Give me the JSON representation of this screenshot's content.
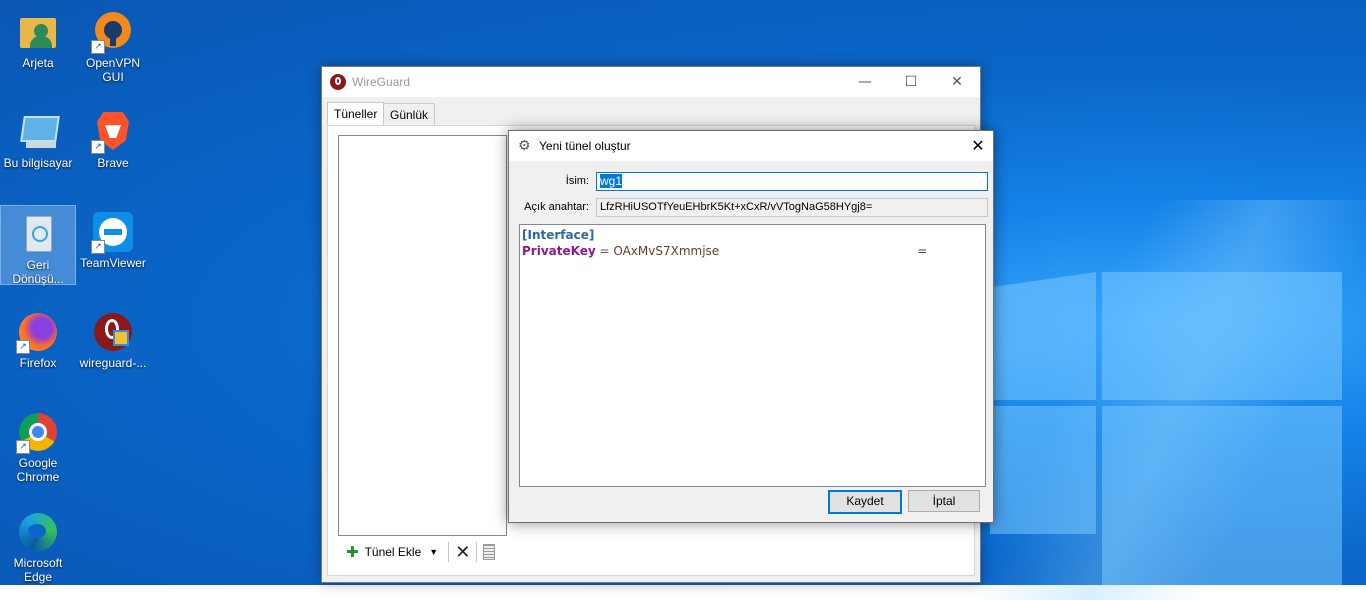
{
  "desktop": {
    "icons": [
      {
        "label": "Arjeta"
      },
      {
        "label": "OpenVPN GUI"
      },
      {
        "label": "Bu bilgisayar"
      },
      {
        "label": "Brave"
      },
      {
        "label": "Geri Dönüşü..."
      },
      {
        "label": "TeamViewer"
      },
      {
        "label": "Firefox"
      },
      {
        "label": "wireguard-..."
      },
      {
        "label": "Google Chrome"
      },
      {
        "label": "Microsoft Edge"
      }
    ]
  },
  "main_window": {
    "title": "WireGuard",
    "controls": {
      "minimize": "—",
      "maximize": "☐",
      "close": "✕"
    },
    "tabs": [
      {
        "label": "Tüneller",
        "active": true
      },
      {
        "label": "Günlük",
        "active": false
      }
    ],
    "toolbar": {
      "add_label": "Tünel Ekle",
      "dropdown": "▼",
      "delete": "✕"
    }
  },
  "dialog": {
    "title": "Yeni tünel oluştur",
    "close": "✕",
    "name_label": "İsim:",
    "name_value": "wg1",
    "pubkey_label": "Açık anahtar:",
    "pubkey_value": "LfzRHiUSOTfYeuEHbrK5Kt+xCxR/vVTogNaG58HYgj8=",
    "config": {
      "section": "[Interface]",
      "key": "PrivateKey",
      "eq": " = ",
      "value": "OAxMvS7Xmmjse",
      "trailing": "="
    },
    "save_label": "Kaydet",
    "cancel_label": "İptal"
  },
  "colors": {
    "accent": "#0078d7",
    "section": "#2a6a9e",
    "key": "#8b1a8b",
    "value": "#6b3a2a"
  }
}
